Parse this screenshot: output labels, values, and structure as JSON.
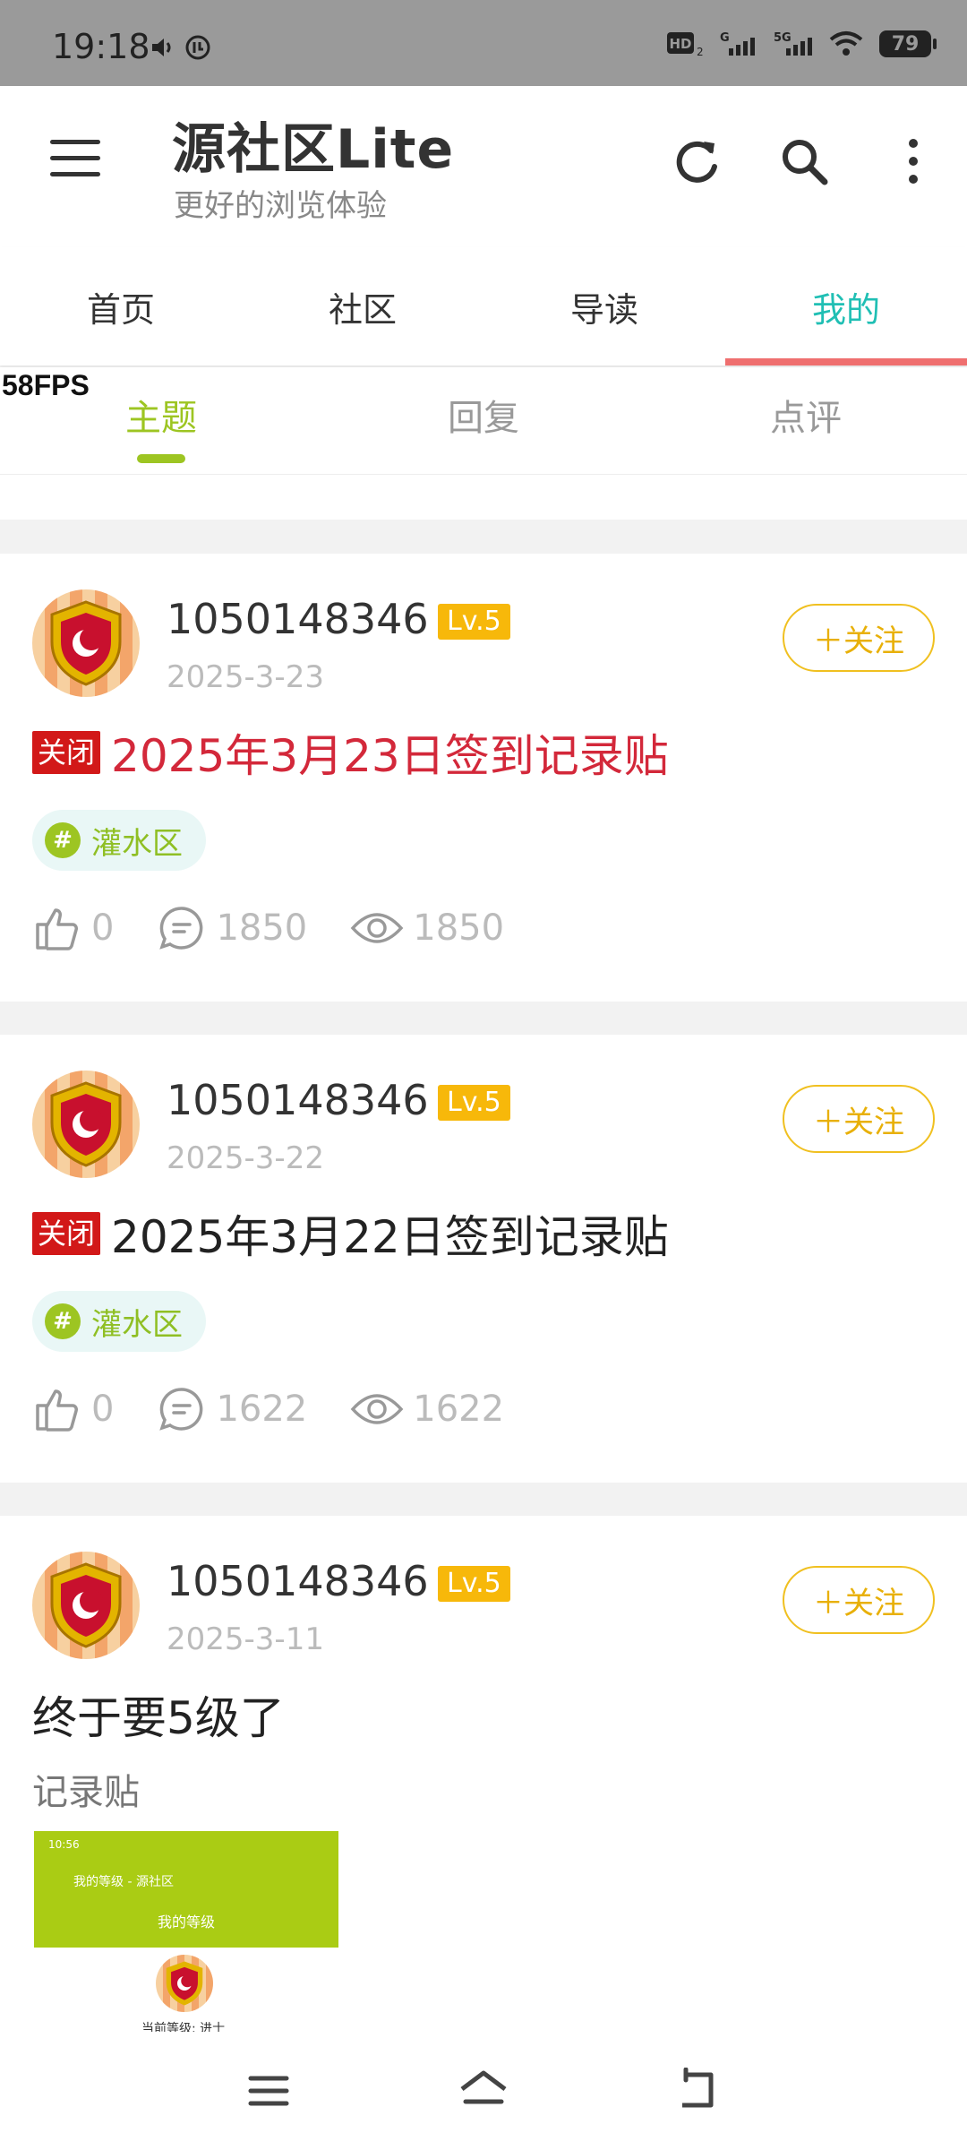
{
  "status_bar": {
    "time": "19:18",
    "battery": "79",
    "network_labels": [
      "HD",
      "G",
      "5G"
    ]
  },
  "header": {
    "title": "源社区Lite",
    "subtitle": "更好的浏览体验",
    "icons": [
      "menu-icon",
      "refresh-icon",
      "search-icon",
      "more-vertical-icon"
    ]
  },
  "tabs": [
    {
      "label": "首页",
      "active": false
    },
    {
      "label": "社区",
      "active": false
    },
    {
      "label": "导读",
      "active": false
    },
    {
      "label": "我的",
      "active": true
    }
  ],
  "subtabs": [
    {
      "label": "主题",
      "active": true
    },
    {
      "label": "回复",
      "active": false
    },
    {
      "label": "点评",
      "active": false
    }
  ],
  "fps_overlay": "58FPS",
  "posts": [
    {
      "username": "1050148346",
      "level": "Lv.5",
      "date": "2025-3-23",
      "follow_label": "＋关注",
      "closed_tag": "关闭",
      "title": "2025年3月23日签到记录贴",
      "title_color": "#d3283a",
      "topic": "灌水区",
      "likes": "0",
      "comments": "1850",
      "views": "1850"
    },
    {
      "username": "1050148346",
      "level": "Lv.5",
      "date": "2025-3-22",
      "follow_label": "＋关注",
      "closed_tag": "关闭",
      "title": "2025年3月22日签到记录贴",
      "title_color": "#222222",
      "topic": "灌水区",
      "likes": "0",
      "comments": "1622",
      "views": "1622"
    },
    {
      "username": "1050148346",
      "level": "Lv.5",
      "date": "2025-3-11",
      "follow_label": "＋关注",
      "title": "终于要5级了",
      "excerpt": "记录贴",
      "thumbnail": {
        "status_time": "10:56",
        "page_title": "我的等级 - 源社区",
        "header": "我的等级",
        "caption": "当前等级: 进士"
      }
    }
  ],
  "colors": {
    "accent_teal": "#20bfb4",
    "tab_underline": "#ef6f6f",
    "accent_green": "#9dc522",
    "level_badge": "#f7b80a",
    "closed_tag": "#d21818"
  }
}
